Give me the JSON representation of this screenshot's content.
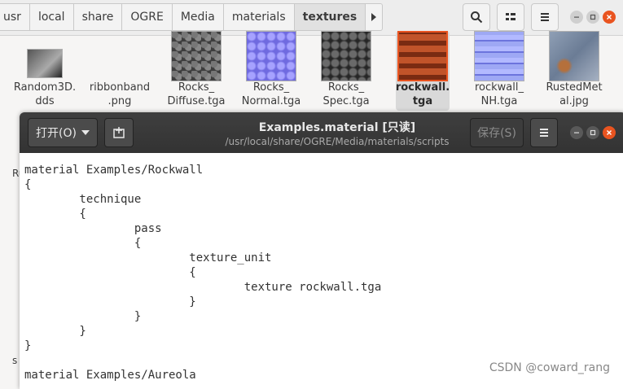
{
  "file_manager": {
    "breadcrumbs": [
      "usr",
      "local",
      "share",
      "OGRE",
      "Media",
      "materials",
      "textures"
    ],
    "active_crumb": "textures",
    "files": [
      {
        "name": "Random3D.\ndds",
        "thumb": "gradient"
      },
      {
        "name": "ribbonband\n.png",
        "thumb": "none"
      },
      {
        "name": "Rocks_\nDiffuse.tga",
        "thumb": "rocks-diffuse"
      },
      {
        "name": "Rocks_\nNormal.tga",
        "thumb": "rocks-normal"
      },
      {
        "name": "Rocks_\nSpec.tga",
        "thumb": "rocks-spec"
      },
      {
        "name": "rockwall.\ntga",
        "thumb": "rockwall",
        "selected": true
      },
      {
        "name": "rockwall_\nNH.tga",
        "thumb": "rockwall-nh"
      },
      {
        "name": "RustedMet\nal.jpg",
        "thumb": "rusted-metal"
      }
    ],
    "left_partial": [
      "Ru",
      "s"
    ]
  },
  "editor": {
    "open_label": "打开(O)",
    "title": "Examples.material [只读]",
    "subtitle": "/usr/local/share/OGRE/Media/materials/scripts",
    "save_label": "保存(S)",
    "content": "material Examples/Rockwall\n{\n        technique\n        {\n                pass\n                {\n                        texture_unit\n                        {\n                                texture rockwall.tga\n                        }\n                }\n        }\n}\n\nmaterial Examples/Aureola"
  },
  "watermark": "CSDN @coward_rang",
  "colors": {
    "accent": "#e95420",
    "header_dark": "#3a3a3a"
  }
}
